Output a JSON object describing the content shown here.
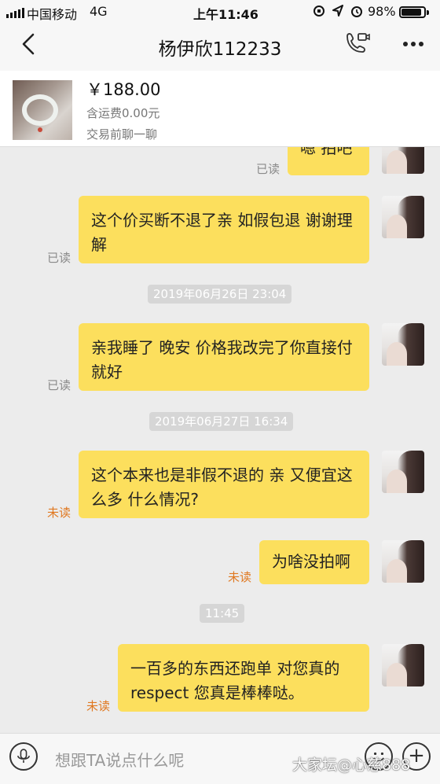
{
  "status_bar": {
    "carrier": "中国移动",
    "network": "4G",
    "time": "上午11:46",
    "battery": "98%",
    "battery_level": 0.98
  },
  "nav": {
    "title": "杨伊欣112233"
  },
  "product": {
    "price": "￥188.00",
    "shipping": "含运费0.00元",
    "note": "交易前聊一聊"
  },
  "messages": [
    {
      "text": "嗯 拍吧",
      "status": "已读"
    },
    {
      "text": "这个价买断不退了亲 如假包退 谢谢理解",
      "status": "已读"
    },
    {
      "timestamp": "2019年06月26日 23:04"
    },
    {
      "text": "亲我睡了 晚安 价格我改完了你直接付就好",
      "status": "已读"
    },
    {
      "timestamp": "2019年06月27日 16:34"
    },
    {
      "text": "这个本来也是非假不退的 亲 又便宜这么多 什么情况?",
      "status": "未读"
    },
    {
      "text": "为啥没拍啊",
      "status": "未读"
    },
    {
      "timestamp": "11:45"
    },
    {
      "text": "一百多的东西还跑单 对您真的respect 您真是棒棒哒。",
      "status": "未读"
    }
  ],
  "input": {
    "placeholder": "想跟TA说点什么呢"
  },
  "watermark": "大家坛@心慈888"
}
